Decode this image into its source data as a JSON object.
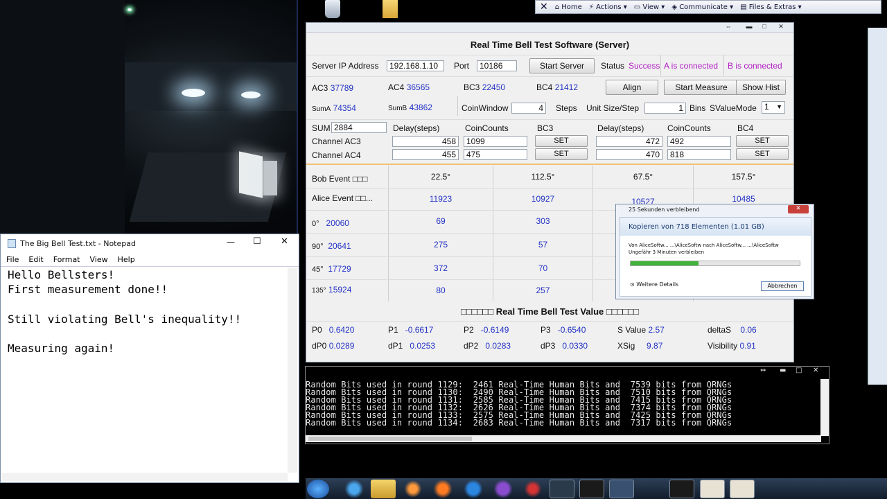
{
  "topbar": {
    "items": [
      "Home",
      "Actions",
      "View",
      "Communicate",
      "Files & Extras"
    ]
  },
  "bell_window": {
    "title": "Real Time Bell Test Software (Server)",
    "server_ip_label": "Server IP Address",
    "server_ip": "192.168.1.10",
    "port_label": "Port",
    "port": "10186",
    "start_server": "Start Server",
    "status_label": "Status",
    "status_value": "Success",
    "a_connected": "A is connected",
    "b_connected": "B is connected",
    "ac3_label": "AC3",
    "ac3": "37789",
    "ac4_label": "AC4",
    "ac4": "36565",
    "bc3_label": "BC3",
    "bc3": "22450",
    "bc4_label": "BC4",
    "bc4": "21412",
    "align": "Align",
    "start_measure": "Start Measure",
    "show_hist": "Show Hist",
    "suma_label": "SumA",
    "suma": "74354",
    "sumb_label": "SumB",
    "sumb": "43862",
    "coin_window_label": "CoinWindow",
    "coin_window": "4",
    "steps_label": "Steps",
    "unit_size_label": "Unit Size/Step",
    "unit_size": "1",
    "bins_label": "Bins",
    "svaluemode_label": "SValueMode",
    "svaluemode": "1",
    "sum_label": "SUM",
    "sum": "2884",
    "delay_steps": "Delay(steps)",
    "coin_counts": "CoinCounts",
    "bc3_head": "BC3",
    "bc4_head": "BC4",
    "channel_ac3": "Channel AC3",
    "channel_ac4": "Channel AC4",
    "ac3_delay_bc3": "458",
    "ac3_coin_bc3": "1099",
    "ac3_delay_bc4": "472",
    "ac3_coin_bc4": "492",
    "ac4_delay_bc3": "455",
    "ac4_coin_bc3": "475",
    "ac4_delay_bc4": "470",
    "ac4_coin_bc4": "818",
    "set": "SET",
    "bob_event": "Bob Event □□□",
    "alice_event": "Alice Event □□...",
    "bob_angles": [
      "22.5°",
      "112.5°",
      "67.5°",
      "157.5°"
    ],
    "alice_counts": [
      "11923",
      "10927",
      "10527",
      "10485"
    ],
    "rows": [
      {
        "angle": "0°",
        "total": "20060",
        "c1": "69",
        "c2": "303"
      },
      {
        "angle": "90°",
        "total": "20641",
        "c1": "275",
        "c2": "57"
      },
      {
        "angle": "45°",
        "total": "17729",
        "c1": "372",
        "c2": "70"
      },
      {
        "angle": "135°",
        "total": "15924",
        "c1": "80",
        "c2": "257"
      }
    ],
    "value_title": "□□□□□□ Real Time Bell Test Value □□□□□□",
    "p0_label": "P0",
    "p0": "0.6420",
    "p1_label": "P1",
    "p1": "-0.6617",
    "p2_label": "P2",
    "p2": "-0.6149",
    "p3_label": "P3",
    "p3": "-0.6540",
    "s_label": "S Value",
    "s": "2.57",
    "deltas_label": "deltaS",
    "deltas": "0.06",
    "dp0_label": "dP0",
    "dp0": "0.0289",
    "dp1_label": "dP1",
    "dp1": "0.0253",
    "dp2_label": "dP2",
    "dp2": "0.0283",
    "dp3_label": "dP3",
    "dp3": "0.0330",
    "xsig_label": "XSig",
    "xsig": "9.87",
    "visibility_label": "Visibility",
    "visibility": "0.91"
  },
  "console": {
    "lines": [
      "Random Bits used in round 1129:  2461 Real-Time Human Bits and  7539 bits from QRNGs",
      "Random Bits used in round 1130:  2490 Real-Time Human Bits and  7510 bits from QRNGs",
      "Random Bits used in round 1131:  2585 Real-Time Human Bits and  7415 bits from QRNGs",
      "Random Bits used in round 1132:  2626 Real-Time Human Bits and  7374 bits from QRNGs",
      "Random Bits used in round 1133:  2575 Real-Time Human Bits and  7425 bits from QRNGs",
      "Random Bits used in round 1134:  2683 Real-Time Human Bits and  7317 bits from QRNGs"
    ]
  },
  "notepad": {
    "title": "The Big Bell Test.txt - Notepad",
    "menu": [
      "File",
      "Edit",
      "Format",
      "View",
      "Help"
    ],
    "lines": [
      "Hello Bellsters!",
      "",
      "First measurement done!!",
      "",
      "Still violating Bell's inequality!!",
      "",
      "Measuring again!"
    ]
  },
  "copy_dialog": {
    "title": "25 Sekunden verbleibend",
    "heading": "Kopieren von 718 Elementen (1.01 GB)",
    "from_line": "Von AliceSoftw... ...\\AliceSoftw nach AliceSoftw... ...\\AliceSoftw",
    "remaining": "Ungefähr 3 Minuten verbleiben",
    "progress": 0.4,
    "details": "Weitere Details",
    "cancel": "Abbrechen"
  }
}
